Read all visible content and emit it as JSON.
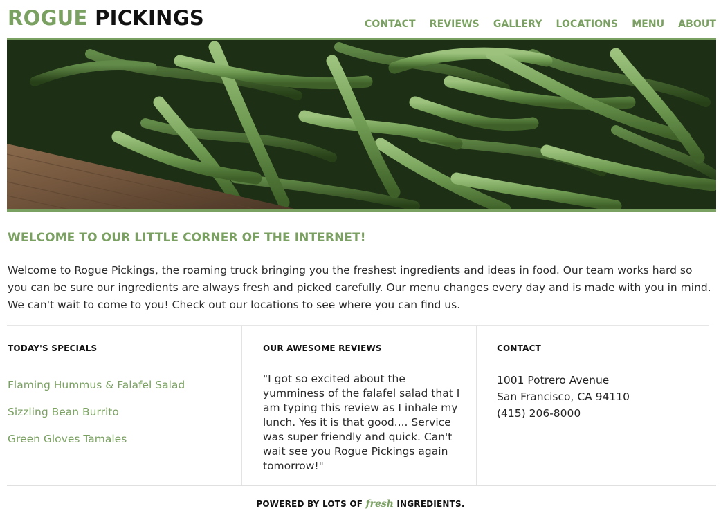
{
  "colors": {
    "accent": "#7aa062",
    "dark_text": "#111111",
    "body_text": "#2a2a2a"
  },
  "header": {
    "logo_accent": "ROGUE",
    "logo_dark": "PICKINGS",
    "nav": [
      "CONTACT",
      "REVIEWS",
      "GALLERY",
      "LOCATIONS",
      "MENU",
      "ABOUT"
    ]
  },
  "hero": {
    "image": "green-beans-photo"
  },
  "welcome": {
    "title": "WELCOME TO OUR LITTLE CORNER OF THE INTERNET!",
    "body": "Welcome to Rogue Pickings, the roaming truck bringing you the freshest ingredients and ideas in food. Our team works hard so you can be sure our ingredients are always fresh and picked carefully. Our menu changes every day and is made with you in mind. We can't wait to come to you! Check out our locations to see where you can find us."
  },
  "specials": {
    "heading": "TODAY'S SPECIALS",
    "items": [
      "Flaming Hummus & Falafel Salad",
      "Sizzling Bean Burrito",
      "Green Gloves Tamales"
    ]
  },
  "reviews": {
    "heading": "OUR AWESOME REVIEWS",
    "quote": "\"I got so excited about the yumminess of the falafel salad that I am typing this review as I inhale my lunch. Yes it is that good.... Service was super friendly and quick. Can't wait see you Rogue Pickings again tomorrow!\""
  },
  "contact": {
    "heading": "CONTACT",
    "lines": [
      "1001 Potrero Avenue",
      "San Francisco, CA 94110",
      "(415) 206-8000"
    ]
  },
  "footer": {
    "prefix": "POWERED BY LOTS OF",
    "script_word": "fresh",
    "suffix": "INGREDIENTS."
  }
}
